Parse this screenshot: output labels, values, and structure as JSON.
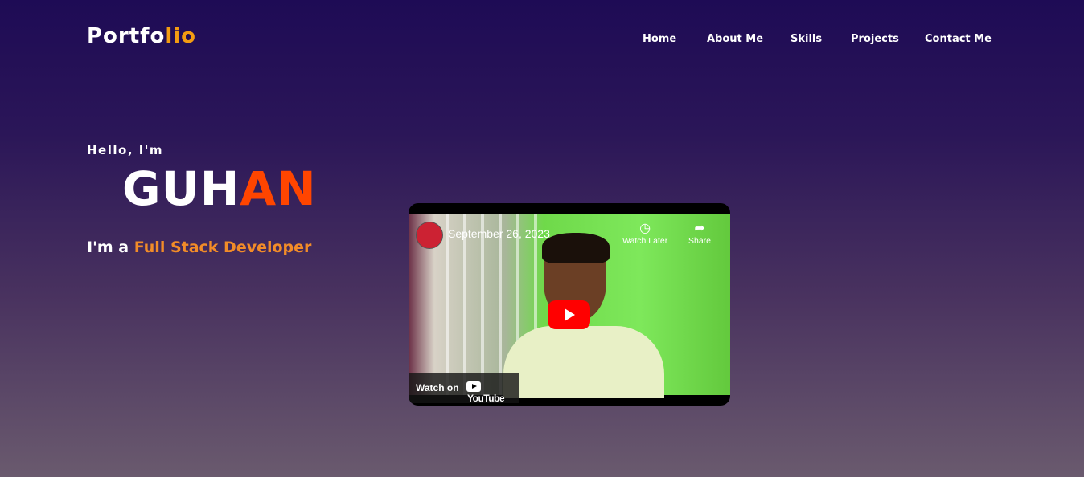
{
  "header": {
    "logo_main": "Portfo",
    "logo_accent": "lio",
    "nav": [
      "Home",
      "About Me",
      "Skills",
      "Projects",
      "Contact Me"
    ]
  },
  "hero": {
    "greeting": "Hello, I'm",
    "name_main": "GUH",
    "name_accent": "AN",
    "role_prefix": "I'm a",
    "role_highlight": "Full Stack Developer"
  },
  "video": {
    "title": "September 26, 2023",
    "watch_later": "Watch Later",
    "share": "Share",
    "watch_on": "Watch on",
    "brand": "YouTube"
  },
  "colors": {
    "logo_accent": "#f39c12",
    "name_accent": "#ff4500",
    "role_accent": "#f28c28",
    "bg_top": "#1e0b55",
    "bg_bottom": "#6a5a6e"
  }
}
